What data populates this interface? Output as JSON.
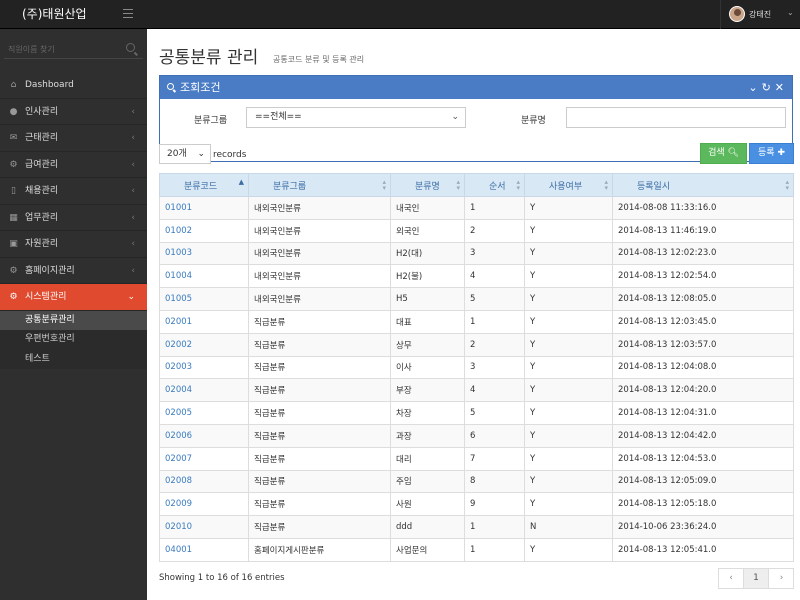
{
  "brand": "(주)태원산업",
  "user": {
    "name": "강태진"
  },
  "sidebar": {
    "search_placeholder": "직원이름 찾기",
    "items": [
      {
        "label": "Dashboard",
        "icon": "home-icon",
        "glyph": "⌂"
      },
      {
        "label": "인사관리",
        "icon": "user-icon",
        "glyph": "●"
      },
      {
        "label": "근태관리",
        "icon": "mail-icon",
        "glyph": "✉"
      },
      {
        "label": "급여관리",
        "icon": "cogs-icon",
        "glyph": "⚙"
      },
      {
        "label": "채용관리",
        "icon": "bookmark-icon",
        "glyph": "▯"
      },
      {
        "label": "업무관리",
        "icon": "table-icon",
        "glyph": "▦"
      },
      {
        "label": "자원관리",
        "icon": "briefcase-icon",
        "glyph": "▣"
      },
      {
        "label": "홈페이지관리",
        "icon": "cogs-icon",
        "glyph": "⚙"
      },
      {
        "label": "시스템관리",
        "icon": "cogs-icon",
        "glyph": "⚙"
      }
    ],
    "sub_items": [
      "공통분류관리",
      "우편번호관리",
      "테스트"
    ]
  },
  "page": {
    "title": "공통분류 관리",
    "subtitle": "공통코드 분류 및 등록 관리"
  },
  "panel": {
    "title": "조회조건",
    "group_label": "분류그룹",
    "group_value": "==전체==",
    "name_label": "분류명",
    "name_value": ""
  },
  "toolbar": {
    "page_length": "20개",
    "records_label": "records",
    "search_label": "검색",
    "register_label": "등록"
  },
  "table": {
    "columns": [
      "분류코드",
      "분류그룹",
      "분류명",
      "순서",
      "사용여부",
      "등록일시"
    ],
    "rows": [
      [
        "01001",
        "내외국인분류",
        "내국인",
        "1",
        "Y",
        "2014-08-08 11:33:16.0"
      ],
      [
        "01002",
        "내외국인분류",
        "외국인",
        "2",
        "Y",
        "2014-08-13 11:46:19.0"
      ],
      [
        "01003",
        "내외국인분류",
        "H2(대)",
        "3",
        "Y",
        "2014-08-13 12:02:23.0"
      ],
      [
        "01004",
        "내외국인분류",
        "H2(불)",
        "4",
        "Y",
        "2014-08-13 12:02:54.0"
      ],
      [
        "01005",
        "내외국인분류",
        "H5",
        "5",
        "Y",
        "2014-08-13 12:08:05.0"
      ],
      [
        "02001",
        "직급분류",
        "대표",
        "1",
        "Y",
        "2014-08-13 12:03:45.0"
      ],
      [
        "02002",
        "직급분류",
        "상무",
        "2",
        "Y",
        "2014-08-13 12:03:57.0"
      ],
      [
        "02003",
        "직급분류",
        "이사",
        "3",
        "Y",
        "2014-08-13 12:04:08.0"
      ],
      [
        "02004",
        "직급분류",
        "부장",
        "4",
        "Y",
        "2014-08-13 12:04:20.0"
      ],
      [
        "02005",
        "직급분류",
        "차장",
        "5",
        "Y",
        "2014-08-13 12:04:31.0"
      ],
      [
        "02006",
        "직급분류",
        "과장",
        "6",
        "Y",
        "2014-08-13 12:04:42.0"
      ],
      [
        "02007",
        "직급분류",
        "대리",
        "7",
        "Y",
        "2014-08-13 12:04:53.0"
      ],
      [
        "02008",
        "직급분류",
        "주임",
        "8",
        "Y",
        "2014-08-13 12:05:09.0"
      ],
      [
        "02009",
        "직급분류",
        "사원",
        "9",
        "Y",
        "2014-08-13 12:05:18.0"
      ],
      [
        "02010",
        "직급분류",
        "ddd",
        "1",
        "N",
        "2014-10-06 23:36:24.0"
      ],
      [
        "04001",
        "홈페이지게시판분류",
        "사업문의",
        "1",
        "Y",
        "2014-08-13 12:05:41.0"
      ]
    ]
  },
  "footer": {
    "showing": "Showing 1 to 16 of 16 entries",
    "page": "1",
    "prev": "‹",
    "next": "›"
  },
  "colors": {
    "accent_red": "#e04b2f",
    "panel_blue": "#4a7cc5",
    "btn_green": "#5cb85c",
    "btn_blue": "#4a90e2",
    "link": "#3a7bbf"
  }
}
